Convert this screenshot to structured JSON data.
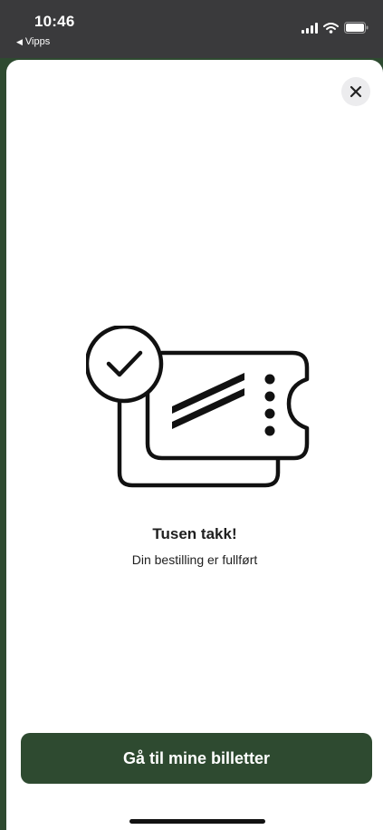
{
  "status_bar": {
    "time": "10:46",
    "back_app": "Vipps",
    "back_icon": "back-triangle-icon",
    "icons": [
      "cellular-signal-icon",
      "wifi-icon",
      "battery-icon"
    ]
  },
  "sheet": {
    "close_icon": "close-icon",
    "illustration_icon": "ticket-checkmark-icon",
    "title": "Tusen takk!",
    "subtitle": "Din bestilling er fullført",
    "cta_label": "Gå til mine billetter"
  },
  "colors": {
    "accent": "#2e4a30",
    "status_bar": "#3a3a3c",
    "close_bg": "#ececee"
  }
}
